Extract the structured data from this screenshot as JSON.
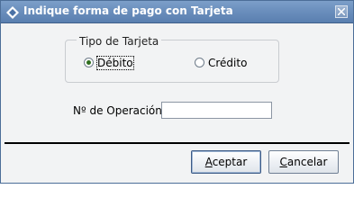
{
  "window": {
    "title": "Indique forma de pago con Tarjeta"
  },
  "card_type": {
    "legend": "Tipo de Tarjeta",
    "options": [
      {
        "label": "Débito",
        "selected": true
      },
      {
        "label": "Crédito",
        "selected": false
      }
    ]
  },
  "operation": {
    "label": "Nº de Operación",
    "value": ""
  },
  "buttons": {
    "accept": {
      "first": "A",
      "rest": "ceptar"
    },
    "cancel": {
      "first": "C",
      "rest": "ancelar"
    }
  },
  "colors": {
    "titlebar": "#6b8fbd",
    "radio_dot": "#2f6e1e"
  }
}
